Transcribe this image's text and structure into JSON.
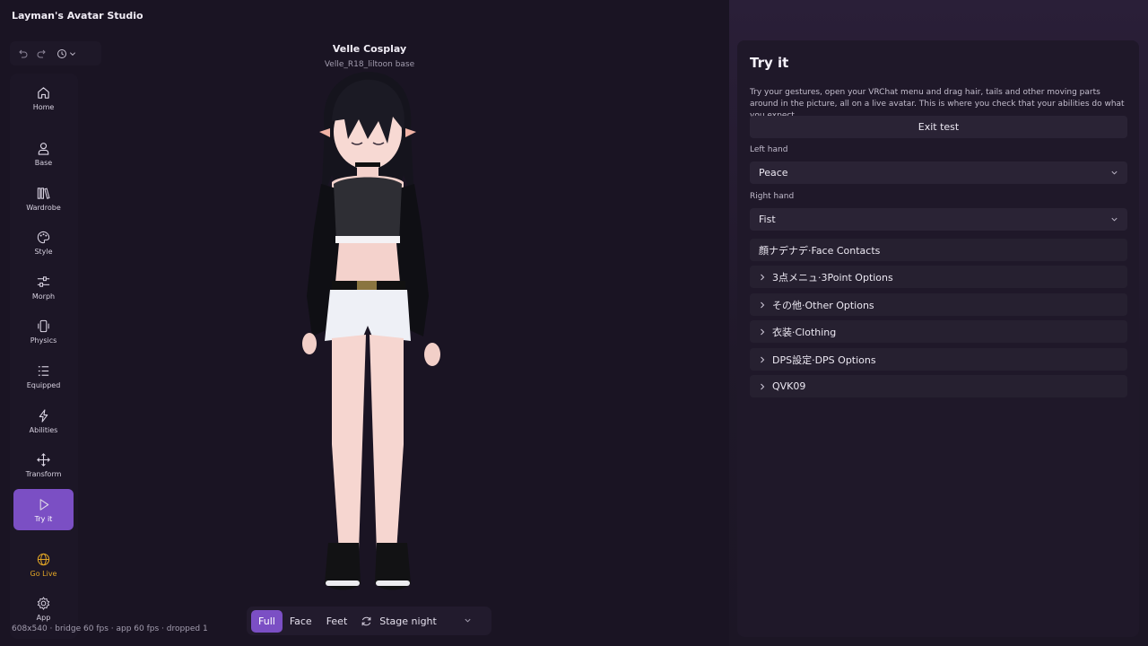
{
  "app": {
    "title": "Layman's Avatar Studio"
  },
  "nav": [
    {
      "id": "home",
      "label": "Home",
      "icon": "home-icon"
    },
    {
      "id": "base",
      "label": "Base",
      "icon": "person-icon"
    },
    {
      "id": "wardrobe",
      "label": "Wardrobe",
      "icon": "library-icon"
    },
    {
      "id": "style",
      "label": "Style",
      "icon": "palette-icon"
    },
    {
      "id": "morph",
      "label": "Morph",
      "icon": "sliders-icon"
    },
    {
      "id": "physics",
      "label": "Physics",
      "icon": "vibrate-icon"
    },
    {
      "id": "equipped",
      "label": "Equipped",
      "icon": "list-icon"
    },
    {
      "id": "abilities",
      "label": "Abilities",
      "icon": "lightning-icon"
    },
    {
      "id": "transform",
      "label": "Transform",
      "icon": "move-icon"
    },
    {
      "id": "tryit",
      "label": "Try it",
      "icon": "play-icon",
      "active": true
    },
    {
      "id": "golive",
      "label": "Go Live",
      "icon": "globe-icon"
    },
    {
      "id": "app",
      "label": "App",
      "icon": "gear-icon"
    }
  ],
  "viewport": {
    "avatar_name": "Velle Cosplay",
    "avatar_base": "Velle_R18_liltoon base",
    "stats": "608x540 · bridge 60 fps · app 60 fps · dropped 1",
    "view_modes": [
      "Full",
      "Face",
      "Feet"
    ],
    "active_view": "Full",
    "stage": "Stage night"
  },
  "panel": {
    "title": "Try it",
    "description": "Try your gestures, open your VRChat menu and drag hair, tails and other moving parts around in the picture, all on a live avatar. This is where you check that your abilities do what you expect.",
    "exit_label": "Exit test",
    "left_hand_label": "Left hand",
    "left_hand_value": "Peace",
    "right_hand_label": "Right hand",
    "right_hand_value": "Fist",
    "sections": [
      {
        "label": "顔ナデナデ·Face Contacts",
        "expandable": false
      },
      {
        "label": "3点メニュ·3Point Options",
        "expandable": true
      },
      {
        "label": "その他·Other Options",
        "expandable": true
      },
      {
        "label": "衣装·Clothing",
        "expandable": true
      },
      {
        "label": "DPS設定·DPS Options",
        "expandable": true
      },
      {
        "label": "QVK09",
        "expandable": true
      }
    ]
  },
  "colors": {
    "accent": "#7b4fc4",
    "golive": "#e0a526",
    "background": "#1a1423"
  }
}
